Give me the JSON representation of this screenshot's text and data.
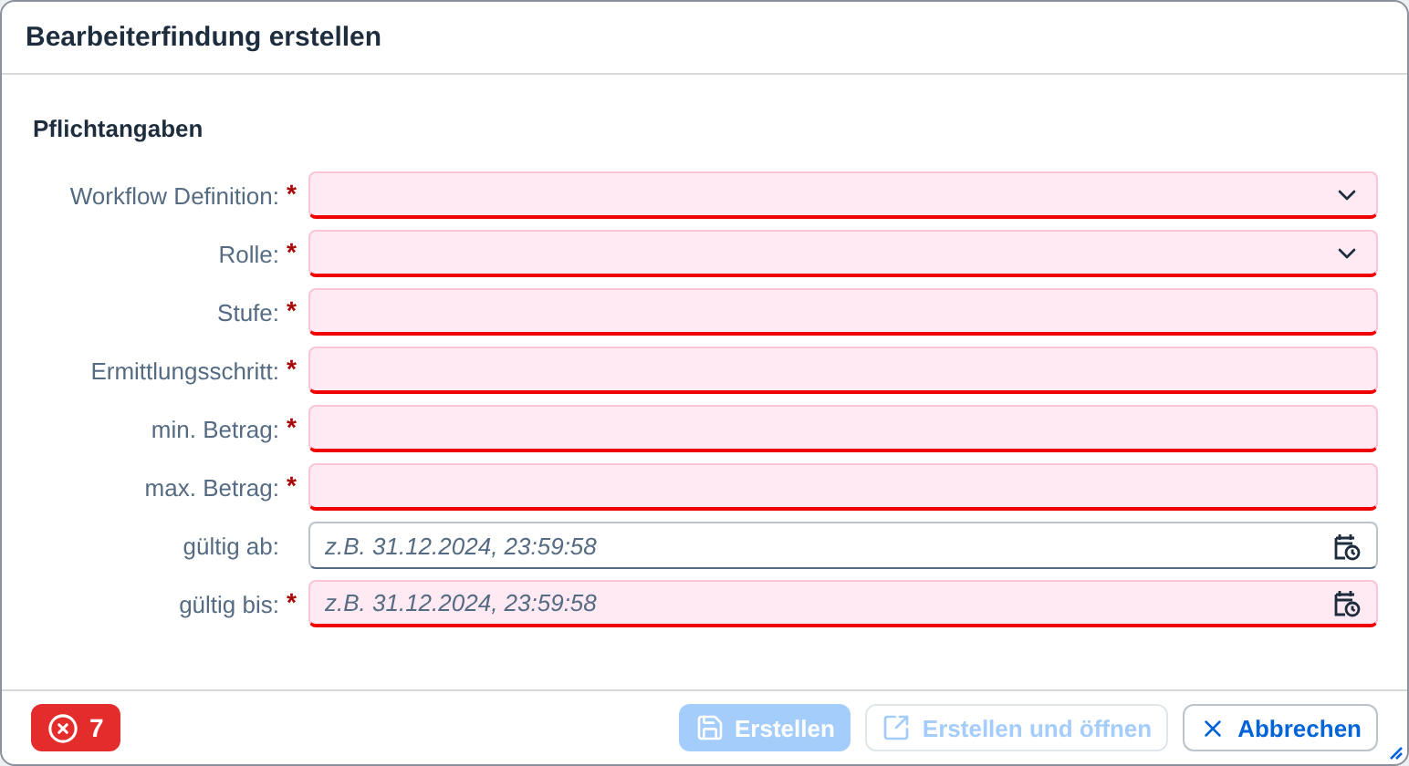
{
  "dialog": {
    "title": "Bearbeiterfindung erstellen"
  },
  "section": {
    "title": "Pflichtangaben"
  },
  "fields": [
    {
      "label": "Workflow Definition:",
      "kind": "select",
      "required_mark": "*",
      "error": true
    },
    {
      "label": "Rolle:",
      "kind": "select",
      "required_mark": "*",
      "error": true
    },
    {
      "label": "Stufe:",
      "kind": "text",
      "required_mark": "*",
      "error": true
    },
    {
      "label": "Ermittlungsschritt:",
      "kind": "text",
      "required_mark": "*",
      "error": true
    },
    {
      "label": "min. Betrag:",
      "kind": "text",
      "required_mark": "*",
      "error": true
    },
    {
      "label": "max. Betrag:",
      "kind": "text",
      "required_mark": "*",
      "error": true
    },
    {
      "label": "gültig ab:",
      "kind": "datetime",
      "error": false,
      "placeholder": "z.B. 31.12.2024, 23:59:58"
    },
    {
      "label": "gültig bis:",
      "kind": "datetime",
      "required_mark": "*",
      "error": true,
      "placeholder": "z.B. 31.12.2024, 23:59:58"
    }
  ],
  "footer": {
    "error_count": "7",
    "buttons": [
      {
        "label": "Erstellen",
        "kind": "save",
        "emphasized": true,
        "disabled": true
      },
      {
        "label": "Erstellen und öffnen",
        "kind": "open",
        "emphasized": false,
        "disabled": true
      },
      {
        "label": "Abbrechen",
        "kind": "cancel",
        "emphasized": false,
        "disabled": false
      }
    ]
  }
}
